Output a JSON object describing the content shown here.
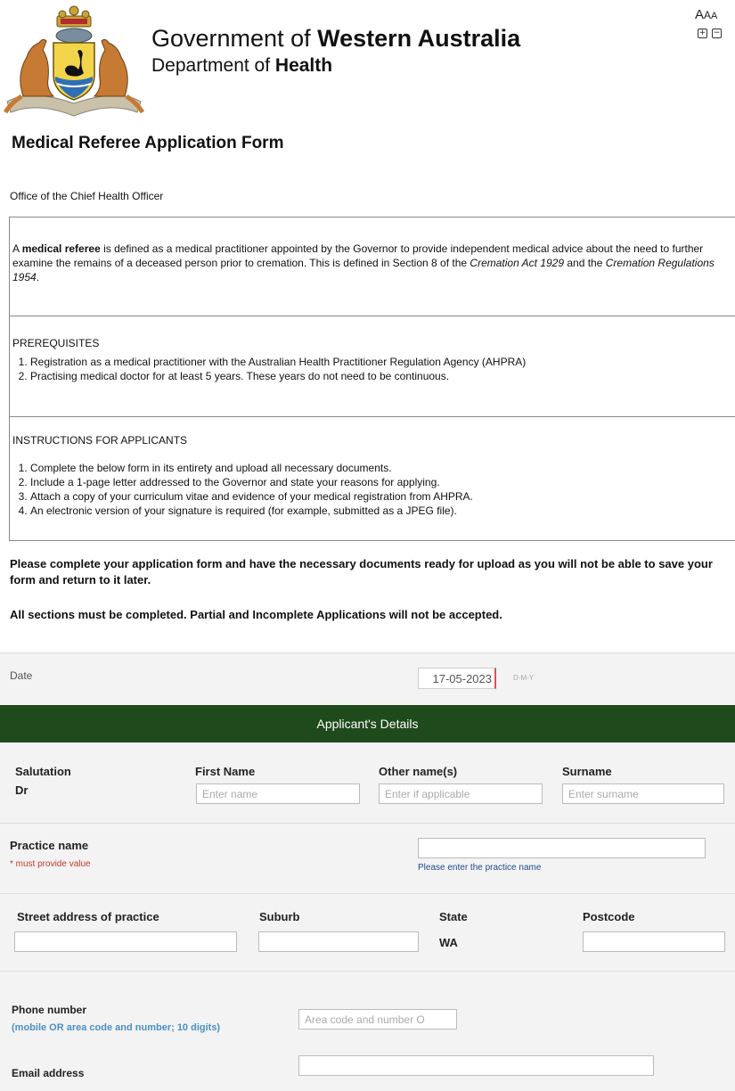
{
  "header": {
    "gov_prefix": "Government of ",
    "gov_bold": "Western Australia",
    "dept_prefix": "Department of ",
    "dept_bold": "Health",
    "text_size_label": "A",
    "text_size_label_2": "A",
    "text_size_label_3": "A",
    "increase_icon": "plus-square-icon",
    "decrease_icon": "minus-square-icon"
  },
  "form_title": "Medical Referee Application Form",
  "office": "Office of the Chief Health Officer",
  "definition": {
    "lead": "A ",
    "term": "medical referee",
    "text1": " is defined as a medical practitioner appointed by the Governor to provide independent medical advice about the need to further examine the remains of a deceased person prior to cremation. This is defined in Section 8 of the ",
    "act1": "Cremation Act 1929",
    "text2": " and the ",
    "act2": "Cremation Regulations 1954",
    "text3": "."
  },
  "prerequisites": {
    "heading": "PREREQUISITES",
    "items": [
      "Registration as a medical practitioner with the Australian Health Practitioner Regulation Agency (AHPRA)",
      "Practising medical doctor for at least 5 years. These years do not need to be continuous."
    ]
  },
  "instructions": {
    "heading": "INSTRUCTIONS FOR APPLICANTS",
    "items": [
      "Complete the below form in its entirety and upload all necessary documents.",
      "Include a 1-page letter addressed to the Governor and state your reasons for applying.",
      "Attach a copy of your curriculum vitae and evidence of your medical registration from AHPRA.",
      "An electronic version of your signature is required (for example, submitted as a JPEG file)."
    ]
  },
  "notice1": "Please complete your application form and have the necessary documents ready for upload as you will not be able to save your form and return to it later.",
  "notice2": "All sections must be completed. Partial and Incomplete Applications will not be accepted.",
  "date": {
    "label": "Date",
    "value": "17-05-2023",
    "format_hint": "D-M-Y"
  },
  "section_title": "Applicant's Details",
  "names": {
    "salutation_label": "Salutation",
    "salutation_value": "Dr",
    "first_label": "First Name",
    "first_placeholder": "Enter name",
    "other_label": "Other name(s)",
    "other_placeholder": "Enter if applicable",
    "surname_label": "Surname",
    "surname_placeholder": "Enter surname"
  },
  "practice": {
    "label": "Practice name",
    "required": "* must provide value",
    "hint": "Please enter the practice name"
  },
  "address": {
    "street_label": "Street address of practice",
    "suburb_label": "Suburb",
    "state_label": "State",
    "state_value": "WA",
    "postcode_label": "Postcode"
  },
  "phone": {
    "label": "Phone number",
    "sublabel": "(mobile OR area code and number; 10 digits)",
    "placeholder": "Area code and number O"
  },
  "email": {
    "label": "Email address"
  }
}
